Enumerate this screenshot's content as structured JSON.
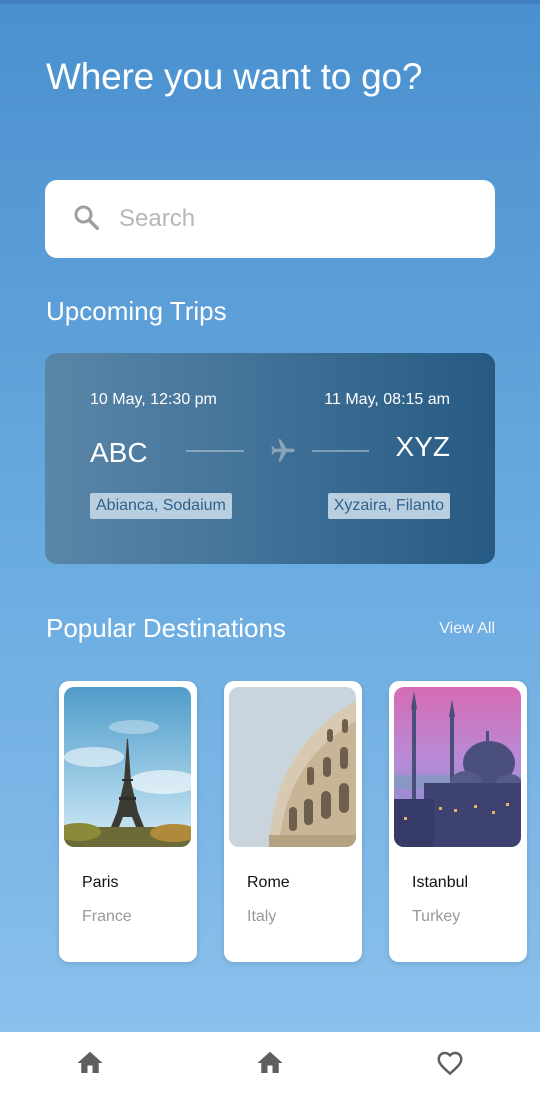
{
  "header": {
    "title": "Where you want to go?"
  },
  "search": {
    "placeholder": "Search",
    "icon": "search-icon"
  },
  "upcoming": {
    "title": "Upcoming Trips",
    "trip": {
      "depart_time": "10 May, 12:30 pm",
      "arrive_time": "11 May, 08:15 am",
      "from_code": "ABC",
      "to_code": "XYZ",
      "from_name": "Abianca, Sodaium",
      "to_name": "Xyzaira, Filanto",
      "icon": "airplane-icon"
    }
  },
  "popular": {
    "title": "Popular Destinations",
    "view_all": "View All",
    "destinations": [
      {
        "city": "Paris",
        "country": "France",
        "image": "eiffel-tower-photo"
      },
      {
        "city": "Rome",
        "country": "Italy",
        "image": "colosseum-photo"
      },
      {
        "city": "Istanbul",
        "country": "Turkey",
        "image": "blue-mosque-photo"
      }
    ]
  },
  "nav": {
    "items": [
      {
        "icon": "home-icon"
      },
      {
        "icon": "home-icon"
      },
      {
        "icon": "heart-icon"
      }
    ]
  },
  "colors": {
    "background_top": "#4a90cf",
    "background_bottom": "#8fc3ee",
    "trip_card": "#3d6f96",
    "tag_bg": "#b9cedf",
    "nav_icon": "#5f5f5f"
  }
}
